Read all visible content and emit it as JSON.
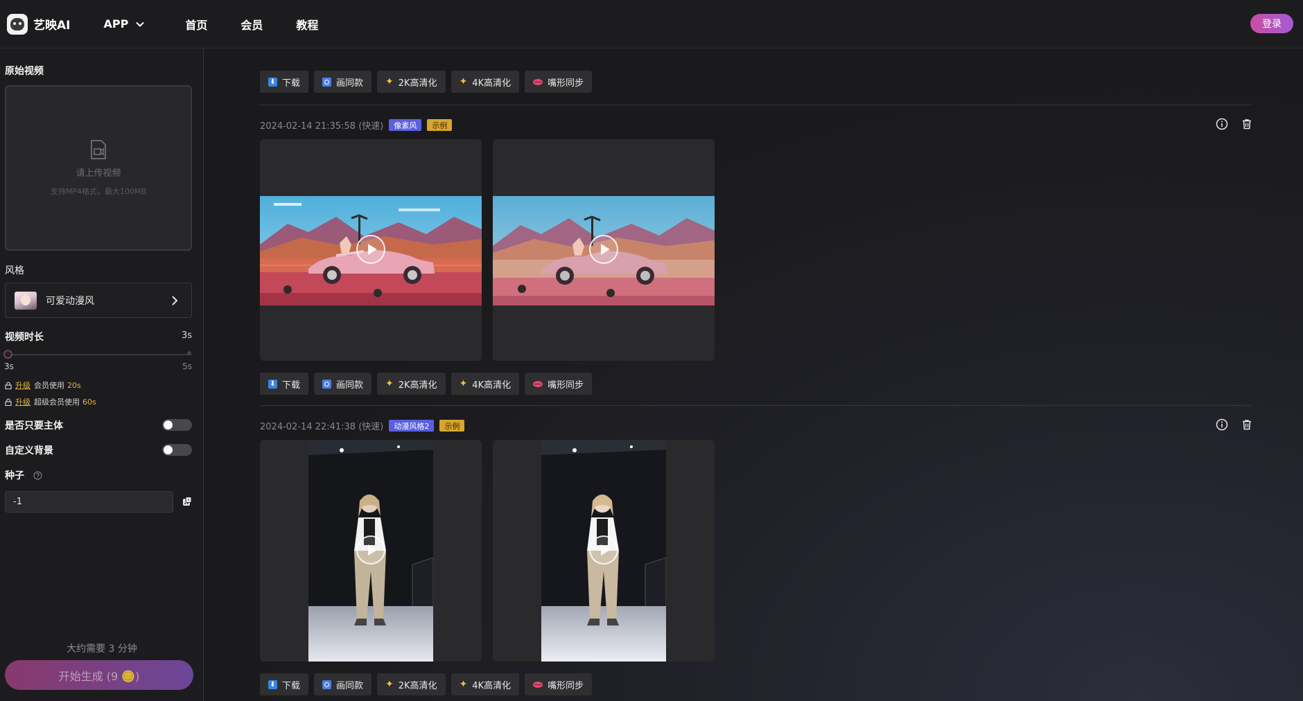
{
  "header": {
    "brand": "艺映AI",
    "nav": [
      {
        "label": "APP",
        "has_dropdown": true
      },
      {
        "label": "首页"
      },
      {
        "label": "会员"
      },
      {
        "label": "教程"
      }
    ],
    "login_label": "登录"
  },
  "sidebar": {
    "original_video_label": "原始视频",
    "upload_hint": "请上传视频",
    "upload_sub": "支持MP4格式，最大100MB",
    "style_label": "风格",
    "style_value": "可爱动漫风",
    "duration_label": "视频时长",
    "duration_value": "3s",
    "slider_min": "3s",
    "slider_max": "5s",
    "slider_value_fraction": 0,
    "upgrade_lines": [
      {
        "link": "升级",
        "text": "会员使用",
        "value": "20s"
      },
      {
        "link": "升级",
        "text": "超级会员使用",
        "value": "60s"
      }
    ],
    "subject_only_label": "是否只要主体",
    "subject_only_on": false,
    "custom_bg_label": "自定义背景",
    "custom_bg_on": false,
    "seed_label": "种子",
    "seed_value": "-1",
    "eta_text": "大约需要 3 分钟",
    "generate_label": "开始生成 (9 🪙)"
  },
  "actions": [
    "下载",
    "画同款",
    "2K高清化",
    "4K高清化",
    "嘴形同步"
  ],
  "entries": [
    {
      "timestamp": "2024-02-14 21:35:58 (快速)",
      "style_tag": "像素风",
      "example_tag": "示例",
      "orientation": "landscape"
    },
    {
      "timestamp": "2024-02-14 22:41:38 (快速)",
      "style_tag": "动漫风格2",
      "example_tag": "示例",
      "orientation": "portrait"
    }
  ],
  "colors": {
    "accent_gradient_start": "#c84fa0",
    "accent_gradient_end": "#a45ad6",
    "tag_style": "#5b5fe0",
    "tag_example": "#d9a52e",
    "upgrade_gold": "#e2b53c"
  }
}
